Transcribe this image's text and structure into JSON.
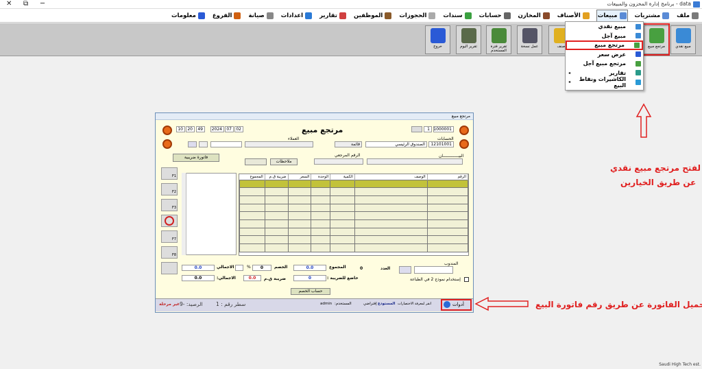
{
  "app": {
    "title": "برنامج إدارة المخزون والمبيعات - data",
    "controls": {
      "close": "✕",
      "restore": "⧉",
      "minimize": "─"
    }
  },
  "menu": [
    {
      "label": "ملف",
      "color": "#7a7a7a"
    },
    {
      "label": "مشتريات",
      "color": "#5a8bd6"
    },
    {
      "label": "مبيعات",
      "color": "#5a8bd6"
    },
    {
      "label": "الأصناف",
      "color": "#e2a020"
    },
    {
      "label": "المخازن",
      "color": "#8a4a2a"
    },
    {
      "label": "حسابات",
      "color": "#666"
    },
    {
      "label": "سندات",
      "color": "#3aa040"
    },
    {
      "label": "الحجوزات",
      "color": "#aaa"
    },
    {
      "label": "الموظفين",
      "color": "#8a5a2a"
    },
    {
      "label": "تقارير",
      "color": "#d04040"
    },
    {
      "label": "اعدادات",
      "color": "#2a7ad6"
    },
    {
      "label": "صيانة",
      "color": "#888"
    },
    {
      "label": "الفروع",
      "color": "#d06010"
    },
    {
      "label": "معلومات",
      "color": "#2a5ad6"
    }
  ],
  "toolbar": [
    {
      "label": "مبيع نقدي",
      "color": "#3a8ad6"
    },
    {
      "label": "مرتجع مبيع",
      "color": "#48a040"
    },
    {
      "label": "صنف",
      "color": "#e0b020"
    },
    {
      "label": "عمل نسخة",
      "color": "#556"
    },
    {
      "label": "تقرير فترة المستخدم",
      "color": "#4a8a3a"
    },
    {
      "label": "تقرير اليوم",
      "color": "#5a6a4a"
    },
    {
      "label": "خروج",
      "color": "#2a5ad6"
    }
  ],
  "dropdown": [
    {
      "label": "مبيع نقدي",
      "color": "#3a8ad6",
      "sub": false
    },
    {
      "label": "مبيع آجل",
      "color": "#3a8ad6",
      "sub": false
    },
    {
      "label": "مرتجع مبيع",
      "color": "#48a040",
      "sub": false,
      "highlight": true
    },
    {
      "label": "عرض سعر",
      "color": "#2a5ad6",
      "sub": false
    },
    {
      "label": "مرتجع مبيع آجل",
      "color": "#48a040",
      "sub": false
    },
    {
      "label": "تقارير",
      "color": "#2a9a8a",
      "sub": true
    },
    {
      "label": "الكاشيرات ونقاط البيع",
      "color": "#2a9ad6",
      "sub": true
    }
  ],
  "annotations": {
    "top_line1": "لفتح مرتجع مبيع نقدي",
    "top_line2": "عن طريق الخيارين",
    "bottom": "لتحميل الفاتورة عن طريق رقم فاتورة البيع"
  },
  "win": {
    "title": "مرتجع مبيع",
    "heading": "مرتجع مبيع",
    "doc_no": "1000001",
    "doc_count": "1",
    "date": {
      "d": "02",
      "m": "07",
      "y": "2024"
    },
    "time": {
      "s": "49",
      "m": "20",
      "h": "10"
    },
    "accounts_label": "الحسابات",
    "account_code": "12101001",
    "account_name": "الصندوق الرئيسي",
    "list_btn": "قائمة",
    "clients_label": "العملاء",
    "statement_label": "البيـــــــــــــان",
    "ref_label": "الرقم المرجعي",
    "notes_btn": "ملاحظات",
    "tax_invoice_btn": "فاتورة ضريبية",
    "grid_headers": [
      "الرقم",
      "الوصف",
      "الكمية",
      "الوحدة",
      "السعر",
      "ضريبة ق.م",
      "المجموع"
    ],
    "delegate_label": "المندوب",
    "count_label": "العدد",
    "count": "0",
    "total_label": "المجموع",
    "total": "0.0",
    "discount_label": "الخصم",
    "discount": "0",
    "pct": "%",
    "gross_label": "الاجمالي",
    "gross": "0.0",
    "taxable_label": "خاضع للضريبة :",
    "taxable": "0",
    "vat_label": "ضريبة ق.م",
    "vat": "0.0",
    "net_label": "الاجمالي:",
    "net": "0.0",
    "calc_discount_btn": "حساب الخصم",
    "print_checkbox": "إستخدام نموذج 2 في الطباعة",
    "tools": "أدوات",
    "hint": "انقر لمعرفة الاختصارات",
    "warehouse_label": "المستودع",
    "warehouse": "إفتراضي",
    "user_label": "المستخدم:",
    "user": "admin",
    "row_label": "سطر رقم : 1",
    "balance_label": "الرصيد: -9",
    "status": "غير مرحلة",
    "side_keys": [
      "F1",
      "F2",
      "F3",
      "",
      "F7",
      "F8"
    ]
  },
  "footer": "Saudi High Tech est."
}
